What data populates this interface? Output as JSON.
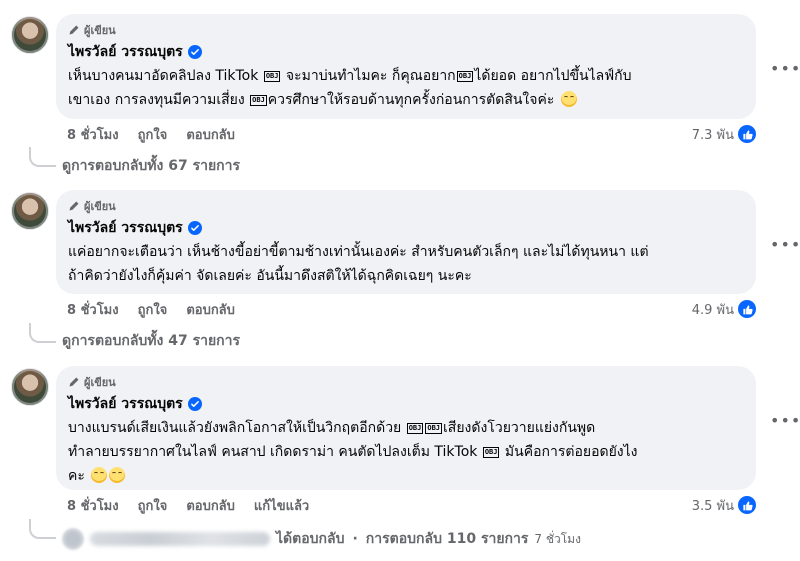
{
  "comments": [
    {
      "badge": "ผู้เขียน",
      "author": "ไพรวัลย์ วรรณบุตร",
      "lines": [
        [
          {
            "t": "เห็นบางคนมาอัดคลิปลง TikTok "
          },
          {
            "obj": "OBJ"
          },
          {
            "t": " จะมาบ่นทำไมคะ ก็คุณอยาก"
          },
          {
            "obj": "OBJ"
          },
          {
            "t": "ได้ยอด อยากไปขึ้นไลฟ์กับ"
          }
        ],
        [
          {
            "t": "เขาเอง การลงทุนมีความเสี่ยง "
          },
          {
            "obj": "OBJ"
          },
          {
            "t": "ควรศึกษาให้รอบด้านทุกครั้งก่อนการตัดสินใจค่ะ "
          },
          {
            "emoji": "rolling-eyes"
          }
        ]
      ],
      "time": "8 ชั่วโมง",
      "like": "ถูกใจ",
      "reply": "ตอบกลับ",
      "edited": "",
      "reactions": "7.3 พัน",
      "replies_link": "ดูการตอบกลับทั้ง 67 รายการ"
    },
    {
      "badge": "ผู้เขียน",
      "author": "ไพรวัลย์ วรรณบุตร",
      "lines": [
        [
          {
            "t": "แค่อยากจะเตือนว่า เห็นช้างขี้อย่าขี้ตามช้างเท่านั้นเองค่ะ สำหรับคนตัวเล็กๆ และไม่ได้ทุนหนา แต่"
          }
        ],
        [
          {
            "t": "ถ้าคิดว่ายังไงก็คุ้มค่า จัดเลยค่ะ อันนี้มาดึงสติให้ได้ฉุกคิดเฉยๆ นะคะ"
          }
        ]
      ],
      "time": "8 ชั่วโมง",
      "like": "ถูกใจ",
      "reply": "ตอบกลับ",
      "edited": "",
      "reactions": "4.9 พัน",
      "replies_link": "ดูการตอบกลับทั้ง 47 รายการ"
    },
    {
      "badge": "ผู้เขียน",
      "author": "ไพรวัลย์ วรรณบุตร",
      "lines": [
        [
          {
            "t": "บางแบรนด์เสียเงินแล้วยังพลิกโอกาสให้เป็นวิกฤตอีกด้วย "
          },
          {
            "obj": "OBJ"
          },
          {
            "obj": "OBJ"
          },
          {
            "t": "เสียงดังโวยวายแย่งกันพูด"
          }
        ],
        [
          {
            "t": "ทำลายบรรยากาศในไลฟ์ คนสาป เกิดดราม่า คนตัดไปลงเต็ม TikTok "
          },
          {
            "obj": "OBJ"
          },
          {
            "t": " มันคือการต่อยอดยังไง"
          }
        ],
        [
          {
            "t": "คะ "
          },
          {
            "emoji": "rolling-eyes"
          },
          {
            "emoji": "rolling-eyes"
          }
        ]
      ],
      "time": "8 ชั่วโมง",
      "like": "ถูกใจ",
      "reply": "ตอบกลับ",
      "edited": "แก้ไขแล้ว",
      "reactions": "3.5 พัน",
      "replies_link": ""
    }
  ],
  "footer": {
    "replied_text": "ได้ตอบกลับ",
    "separator": "·",
    "replies_count_text": "การตอบกลับ 110 รายการ",
    "time": "7 ชั่วโมง"
  },
  "colors": {
    "bubble": "#f0f2f5",
    "secondary_text": "#65676b",
    "accent_blue": "#0866ff"
  },
  "icons": {
    "badge": "pencil-icon",
    "verified": "verified-badge-icon",
    "more": "more-options-icon",
    "reaction": "like-reaction-icon",
    "emoji": "rolling-eyes-emoji"
  }
}
